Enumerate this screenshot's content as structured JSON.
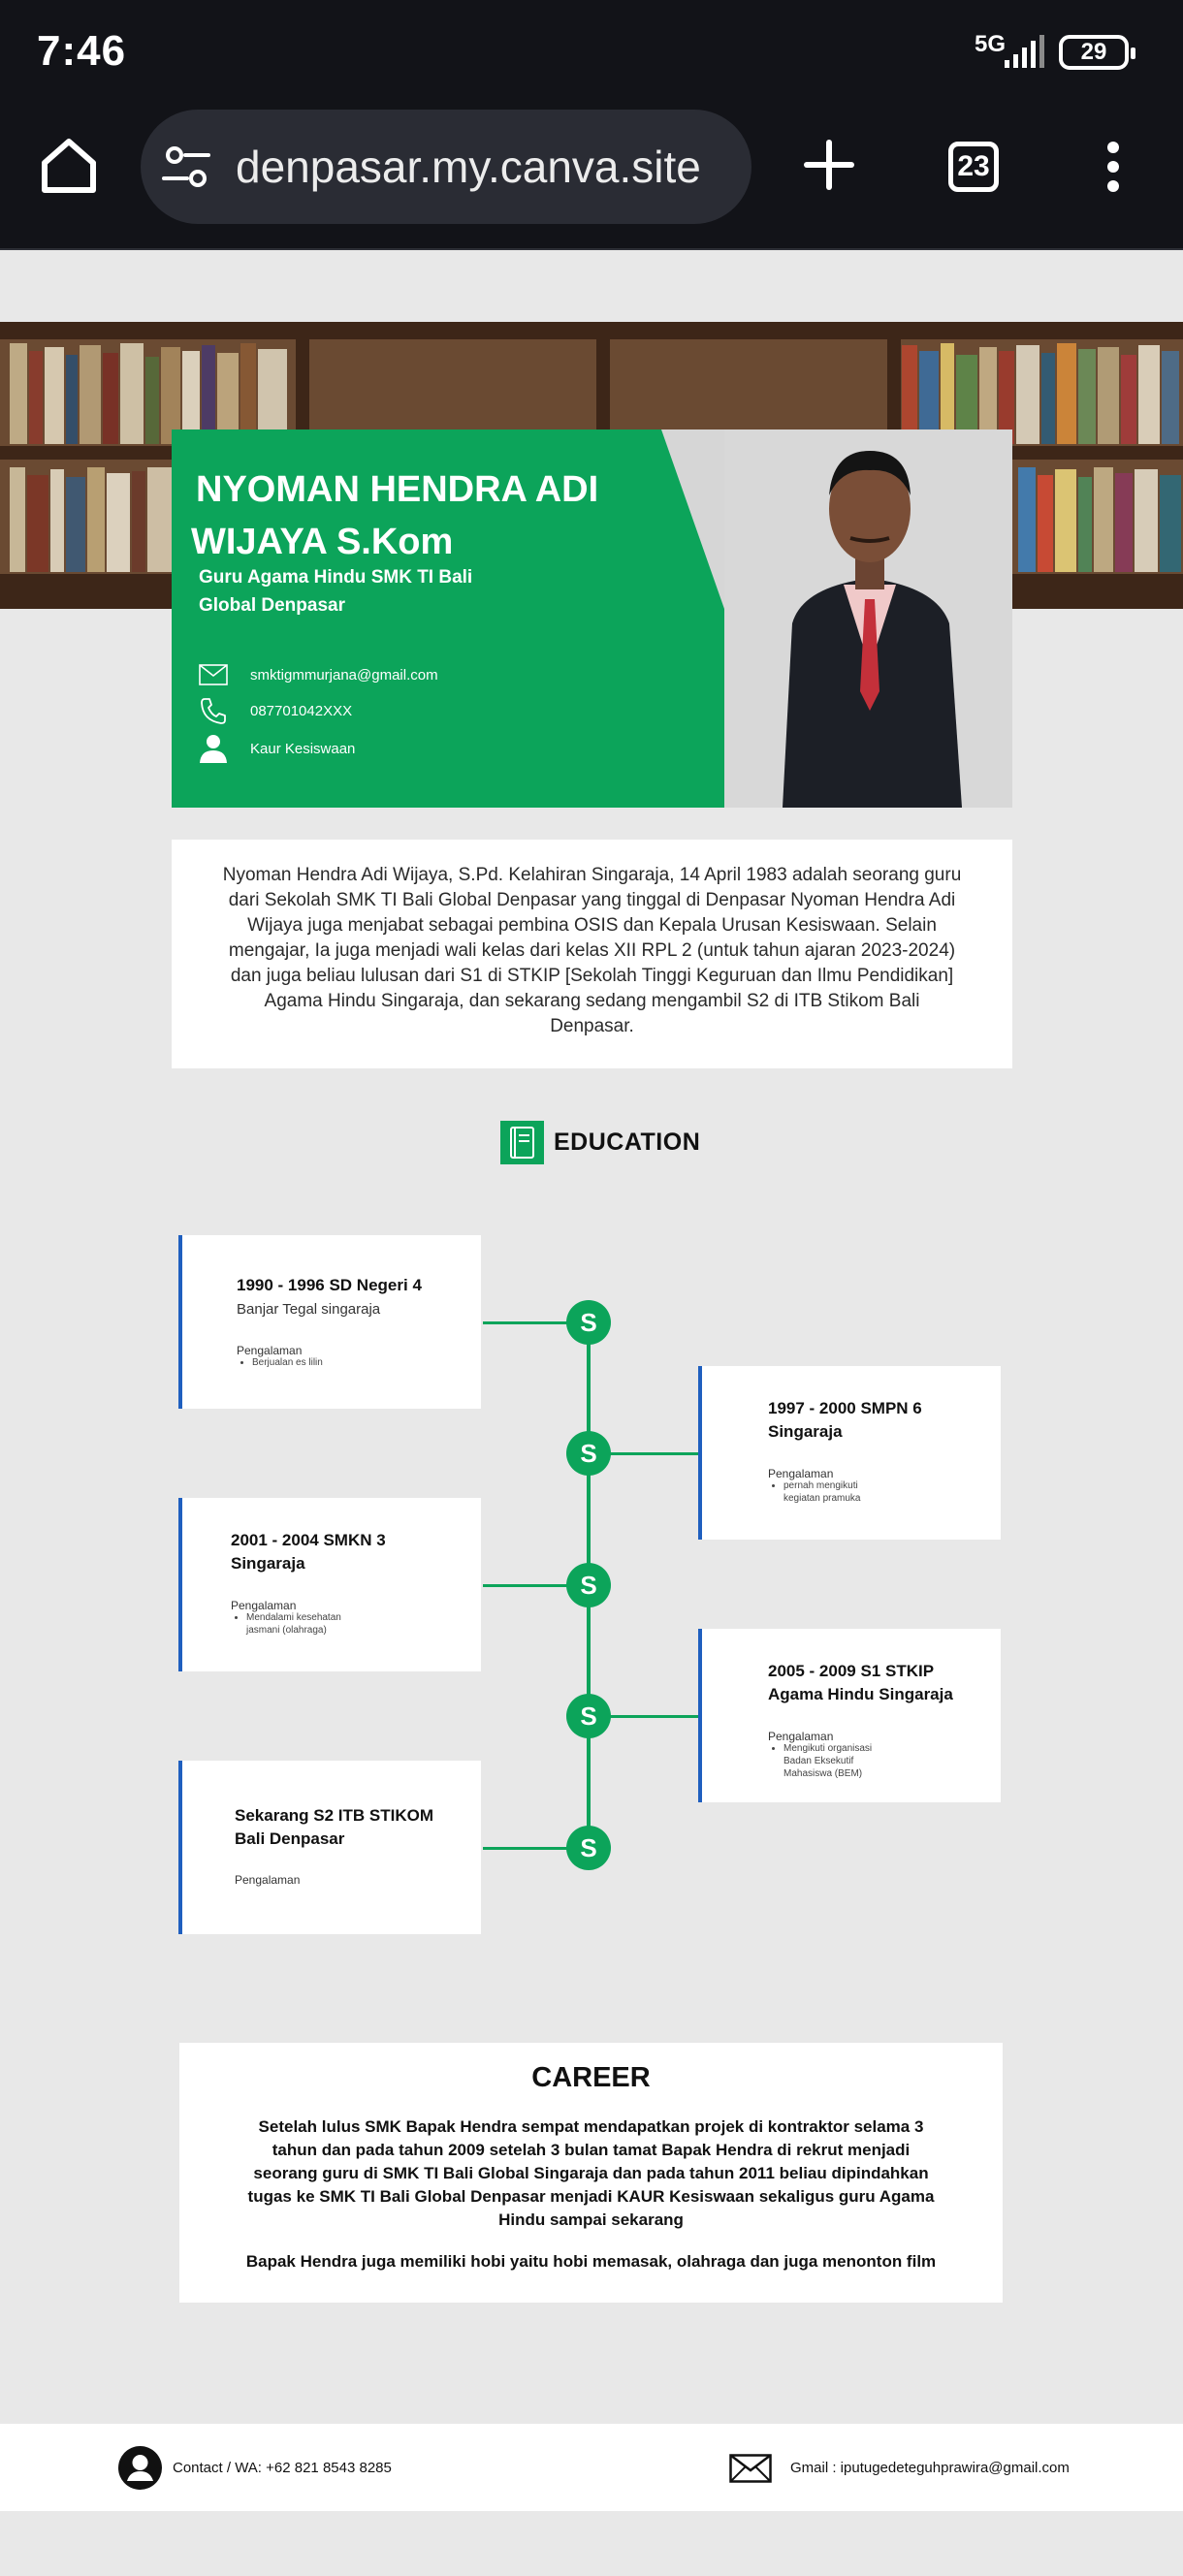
{
  "status_bar": {
    "time": "7:46",
    "network": "5G",
    "battery": "29"
  },
  "browser": {
    "url": "denpasar.my.canva.site",
    "tab_count": "23",
    "icons": [
      "home-icon",
      "tune-icon",
      "plus-icon",
      "tabs-icon",
      "more-vert-icon"
    ]
  },
  "profile": {
    "name_line1": "NYOMAN HENDRA ADI",
    "name_line2": "WIJAYA S.Kom",
    "role_line1": "Guru Agama Hindu SMK TI Bali",
    "role_line2": "Global Denpasar",
    "email": "smktigmmurjana@gmail.com",
    "phone": "087701042XXX",
    "position": "Kaur Kesiswaan"
  },
  "bio": "Nyoman Hendra Adi Wijaya, S.Pd. Kelahiran Singaraja, 14 April 1983 adalah seorang guru dari Sekolah SMK TI Bali Global Denpasar yang tinggal di Denpasar Nyoman Hendra Adi Wijaya juga menjabat sebagai pembina OSIS dan Kepala Urusan Kesiswaan. Selain mengajar, Ia juga menjadi wali kelas dari kelas XII RPL 2 (untuk tahun ajaran 2023-2024) dan juga beliau lulusan dari S1 di STKIP [Sekolah Tinggi Keguruan dan Ilmu Pendidikan] Agama Hindu Singaraja, dan sekarang sedang mengambil S2 di ITB Stikom Bali Denpasar.",
  "education": {
    "title": "EDUCATION",
    "node_label": "S",
    "items": [
      {
        "title": "1990 - 1996 SD Negeri 4",
        "subtitle": "Banjar Tegal singaraja",
        "label": "Pengalaman",
        "bullets": [
          "Berjualan es lilin"
        ]
      },
      {
        "title": "1997 - 2000 SMPN 6 Singaraja",
        "subtitle": "",
        "label": "Pengalaman",
        "bullets": [
          "pernah mengikuti kegiatan pramuka"
        ]
      },
      {
        "title": "2001 - 2004 SMKN 3 Singaraja",
        "subtitle": "",
        "label": "Pengalaman",
        "bullets": [
          "Mendalami kesehatan jasmani (olahraga)"
        ]
      },
      {
        "title": "2005 - 2009 S1 STKIP Agama Hindu Singaraja",
        "subtitle": "",
        "label": "Pengalaman",
        "bullets": [
          "Mengikuti organisasi Badan Eksekutif Mahasiswa (BEM)"
        ]
      },
      {
        "title": "Sekarang S2 ITB STIKOM Bali Denpasar",
        "subtitle": "",
        "label": "Pengalaman",
        "bullets": []
      }
    ]
  },
  "career": {
    "title": "CAREER",
    "text1": "Setelah lulus SMK Bapak Hendra sempat mendapatkan projek di kontraktor selama 3 tahun dan pada tahun 2009 setelah 3 bulan tamat Bapak Hendra di rekrut menjadi seorang guru di SMK TI Bali Global Singaraja dan pada tahun 2011 beliau dipindahkan tugas ke SMK TI Bali Global Denpasar menjadi KAUR Kesiswaan sekaligus guru Agama Hindu sampai sekarang",
    "text2": "Bapak Hendra juga memiliki hobi yaitu hobi memasak, olahraga dan juga menonton film"
  },
  "footer": {
    "contact": "Contact / WA: +62 821 8543 8285",
    "gmail": "Gmail : iputugedeteguhprawira@gmail.com"
  },
  "colors": {
    "brand_green": "#0ca45a",
    "card_accent": "#1f5fbf",
    "chrome_bg": "#121318",
    "page_bg": "#e8e8e8"
  }
}
